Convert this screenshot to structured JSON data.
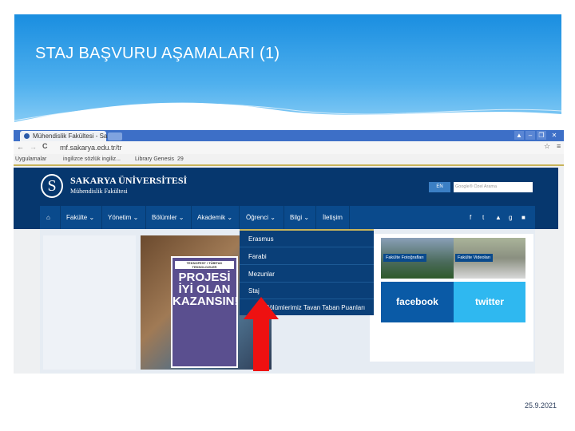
{
  "slide": {
    "title": "STAJ BAŞVURU AŞAMALARI (1)",
    "date": "25.9.2021"
  },
  "browser": {
    "tab_title": "Mühendislik Fakültesi - Sa",
    "url": "mf.sakarya.edu.tr/tr",
    "bookmarks": [
      "Uygulamalar",
      "ingilizce sözlük ingiliz...",
      "Library Genesis",
      "29"
    ],
    "window_buttons": [
      "▲",
      "–",
      "❐",
      "✕"
    ]
  },
  "site": {
    "university": "SAKARYA ÜNİVERSİTESİ",
    "faculty": "Mühendislik Fakültesi",
    "lang_button": "EN",
    "search_placeholder": "Google® Özel Arama",
    "nav": [
      "Fakülte",
      "Yönetim",
      "Bölümler",
      "Akademik",
      "Öğrenci",
      "Bilgi",
      "İletişim"
    ],
    "student_menu": [
      "Erasmus",
      "Farabi",
      "Mezunlar",
      "Staj",
      "Bölümlerimiz Tavan Taban Puanları"
    ],
    "poster": {
      "headline1": "PROJESİ",
      "headline2": "İYİ OLAN",
      "headline3": "KAZANSIN!",
      "tag": "TEKNOFEST / TÜBİTAK TEKNOLOJİLER"
    },
    "photos_label": "Fakülte Fotoğrafları",
    "videos_label": "Fakülte Videoları",
    "facebook": "facebook",
    "twitter": "twitter"
  },
  "colors": {
    "navy": "#06376e",
    "nav": "#0a4a8c",
    "facebook": "#0a5aa6",
    "twitter": "#2fb8f0",
    "arrow": "#ee1111"
  }
}
